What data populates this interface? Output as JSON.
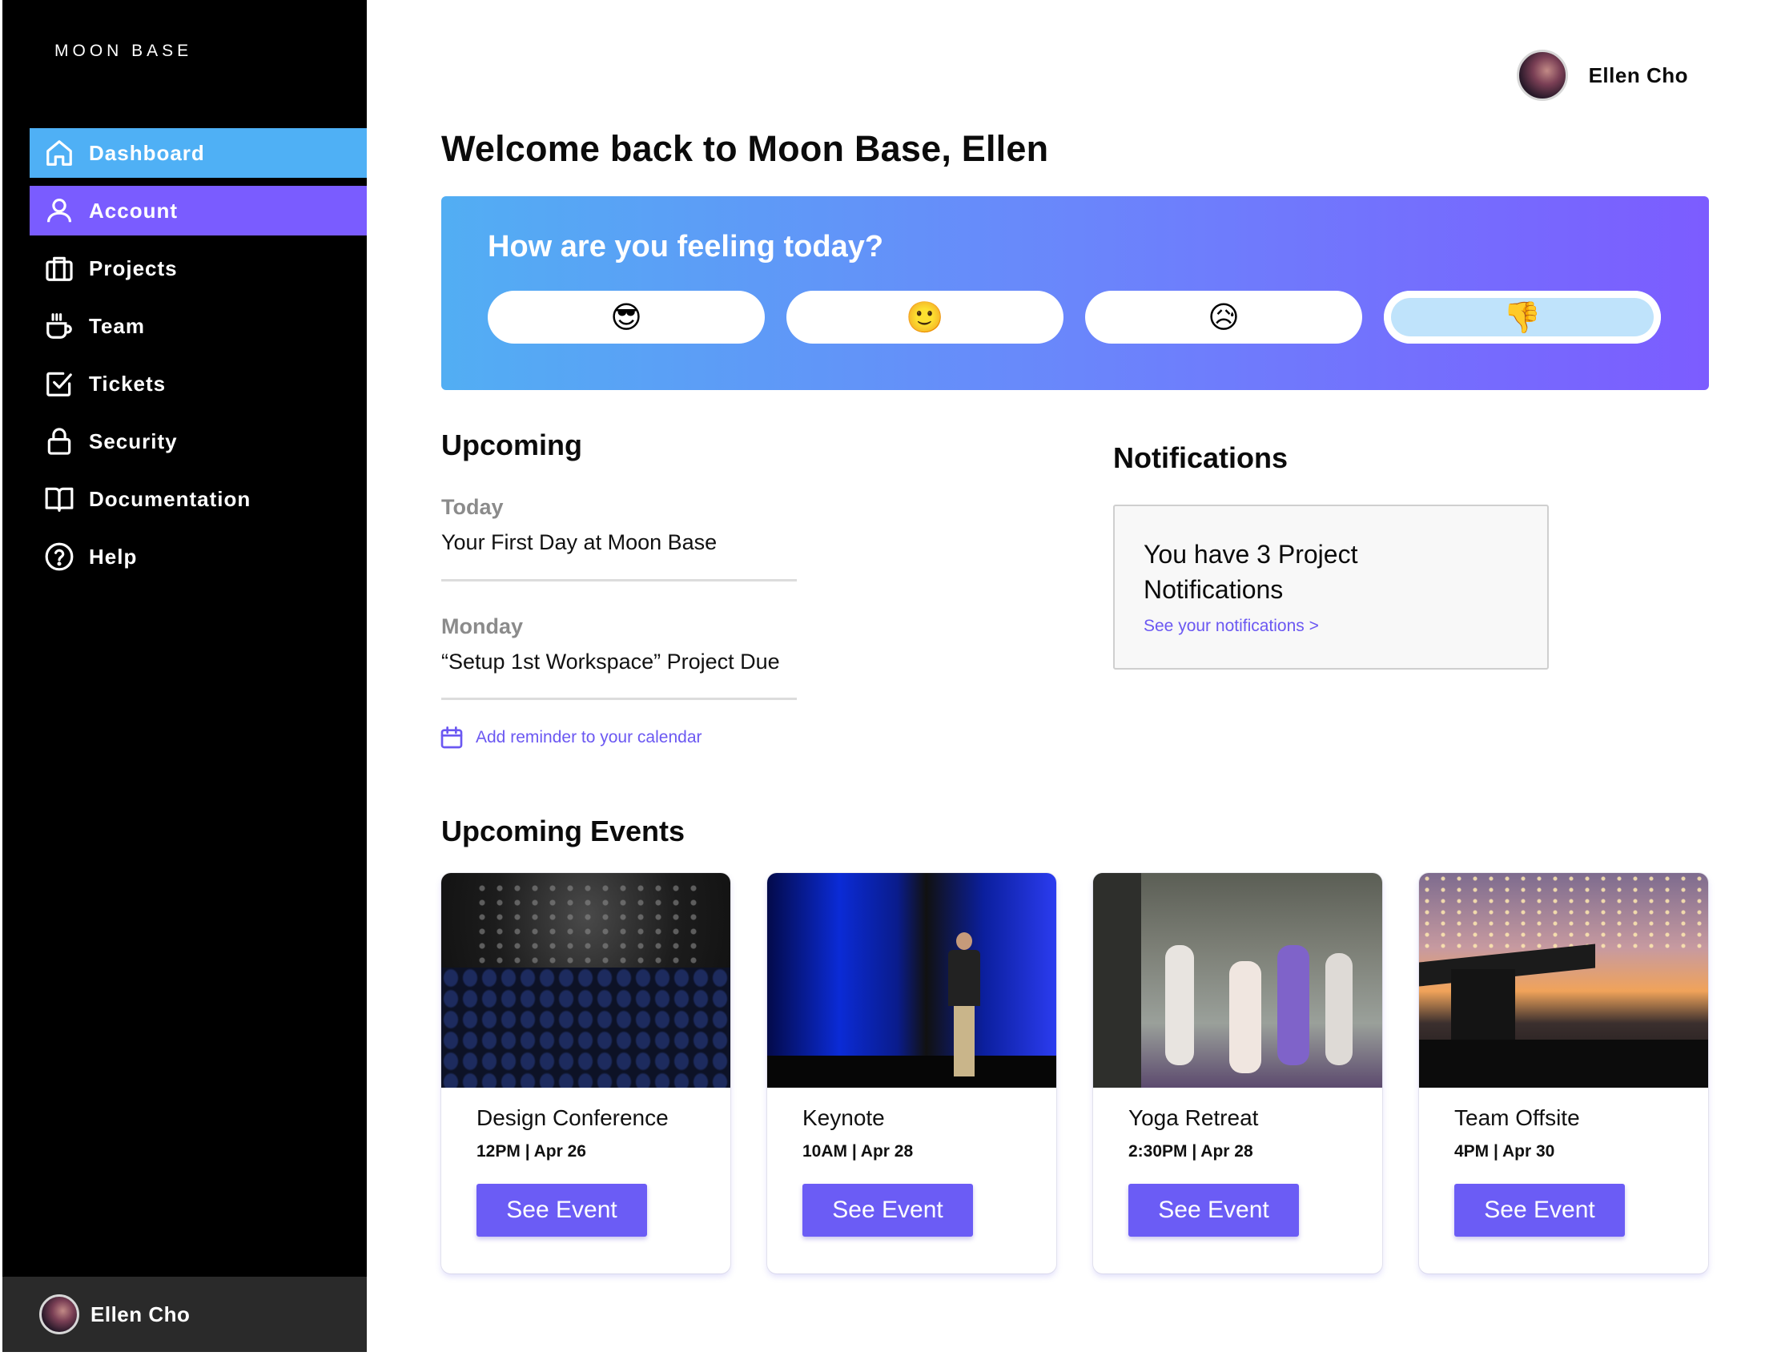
{
  "app": {
    "brand": "MOON BASE"
  },
  "sidebar": {
    "items": [
      {
        "label": "Dashboard",
        "icon": "home-icon"
      },
      {
        "label": "Account",
        "icon": "user-icon"
      },
      {
        "label": "Projects",
        "icon": "briefcase-icon"
      },
      {
        "label": "Team",
        "icon": "coffee-icon"
      },
      {
        "label": "Tickets",
        "icon": "checkbox-icon"
      },
      {
        "label": "Security",
        "icon": "lock-icon"
      },
      {
        "label": "Documentation",
        "icon": "book-icon"
      },
      {
        "label": "Help",
        "icon": "help-icon"
      }
    ],
    "footer_user": "Ellen Cho"
  },
  "header": {
    "user_name": "Ellen Cho"
  },
  "main": {
    "title": "Welcome back to Moon Base, Ellen",
    "mood": {
      "title": "How are you feeling today?",
      "options": [
        "😎",
        "🙂",
        "😥",
        "👎"
      ],
      "selected_index": 3
    },
    "upcoming": {
      "title": "Upcoming",
      "items": [
        {
          "day": "Today",
          "text": "Your First Day at Moon Base"
        },
        {
          "day": "Monday",
          "text": "“Setup 1st Workspace” Project Due"
        }
      ],
      "reminder_link": "Add reminder to your calendar"
    },
    "notifications": {
      "title": "Notifications",
      "message": "You have 3 Project Notifications",
      "link": "See your notifications >"
    },
    "events": {
      "title": "Upcoming Events",
      "items": [
        {
          "title": "Design Conference",
          "meta": "12PM | Apr 26",
          "button": "See Event"
        },
        {
          "title": "Keynote",
          "meta": "10AM | Apr 28",
          "button": "See Event"
        },
        {
          "title": "Yoga Retreat",
          "meta": "2:30PM | Apr 28",
          "button": "See Event"
        },
        {
          "title": "Team Offsite",
          "meta": "4PM | Apr 30",
          "button": "See Event"
        }
      ]
    }
  },
  "colors": {
    "sidebar_bg": "#000000",
    "active_blue": "#4fb0f5",
    "active_purple": "#7a5cff",
    "accent": "#6b5cf5",
    "link": "#6b58f2"
  }
}
